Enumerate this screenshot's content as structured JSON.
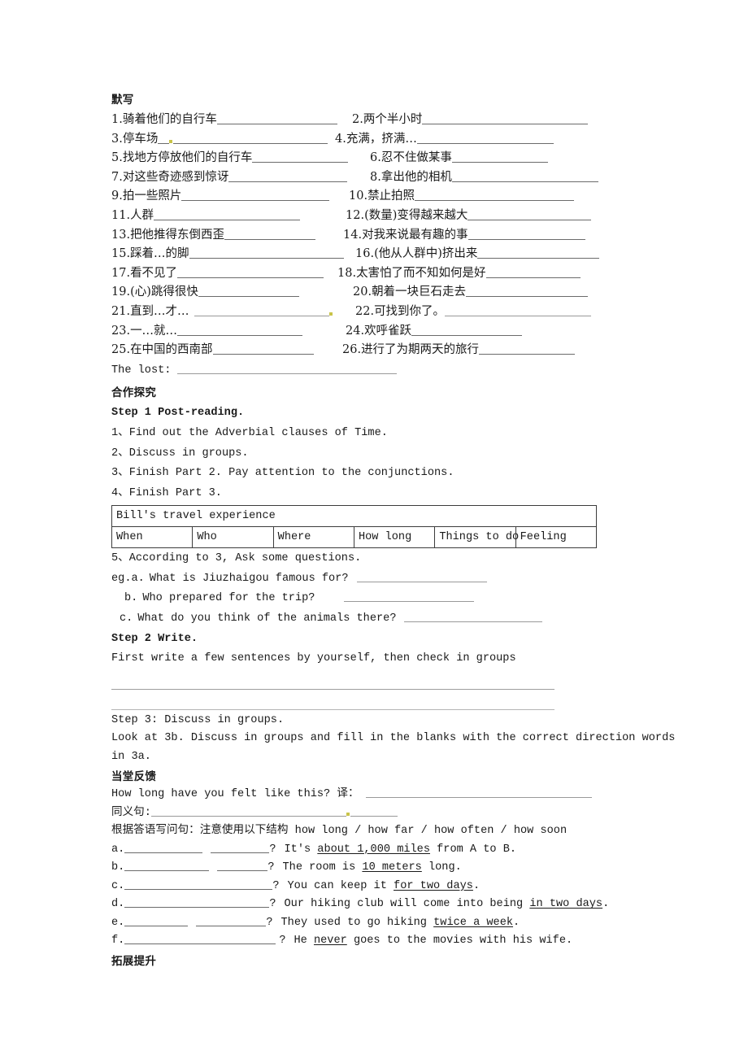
{
  "document": {
    "sections": {
      "dictation_title": "默写",
      "cooperation_title": "合作探究",
      "feedback_title": "当堂反馈",
      "extension_title": "拓展提升"
    },
    "dictation_items": [
      {
        "num": "1.",
        "text": "骑着他们的自行车"
      },
      {
        "num": "2.",
        "text": "两个半小时"
      },
      {
        "num": "3.",
        "text": "停车场"
      },
      {
        "num": "4.",
        "text": "充满，挤满…"
      },
      {
        "num": "5.",
        "text": "找地方停放他们的自行车"
      },
      {
        "num": "6.",
        "text": "忍不住做某事"
      },
      {
        "num": "7.",
        "text": "对这些奇迹感到惊讶"
      },
      {
        "num": "8.",
        "text": "拿出他的相机"
      },
      {
        "num": "9.",
        "text": "拍一些照片"
      },
      {
        "num": "10.",
        "text": "禁止拍照"
      },
      {
        "num": "11.",
        "text": "人群"
      },
      {
        "num": "12.",
        "text": "(数量)变得越来越大"
      },
      {
        "num": "13.",
        "text": "把他推得东倒西歪"
      },
      {
        "num": "14.",
        "text": "对我来说最有趣的事"
      },
      {
        "num": "15.",
        "text": "踩着…的脚"
      },
      {
        "num": "16.",
        "text": "(他从人群中)挤出来"
      },
      {
        "num": "17.",
        "text": "看不见了"
      },
      {
        "num": "18.",
        "text": "太害怕了而不知如何是好"
      },
      {
        "num": "19.",
        "text": "(心)跳得很快"
      },
      {
        "num": "20.",
        "text": "朝着一块巨石走去"
      },
      {
        "num": "21.",
        "text": "直到…才…"
      },
      {
        "num": "22.",
        "text": "可找到你了。"
      },
      {
        "num": "23.",
        "text": "一…就…"
      },
      {
        "num": "24.",
        "text": "欢呼雀跃"
      },
      {
        "num": "25.",
        "text": "在中国的西南部"
      },
      {
        "num": "26.",
        "text": "进行了为期两天的旅行"
      }
    ],
    "the_lost_label": "The lost:",
    "step1": {
      "heading": "Step 1  Post-reading.",
      "items": [
        "1、Find out the Adverbial clauses of Time.",
        "2、Discuss in groups.",
        "3、Finish Part 2. Pay attention to the conjunctions.",
        "4、Finish Part 3."
      ],
      "item5": "5、According to 3, Ask some questions.",
      "questions": [
        {
          "label": "eg.a.",
          "text": "What is Jiuzhaigou famous for?"
        },
        {
          "label": "b.",
          "text": "Who prepared for the trip?"
        },
        {
          "label": "c.",
          "text": "What do you think of the animals there?"
        }
      ]
    },
    "table": {
      "title": "Bill's travel experience",
      "headers": [
        "When",
        "Who",
        "Where",
        "How long",
        "Things to do",
        "Feeling"
      ]
    },
    "step2": {
      "heading": "Step 2 Write.",
      "instruction": "First write a few sentences by yourself, then check in groups"
    },
    "step3": {
      "heading": "Step 3: Discuss in groups.",
      "instruction_line1": "Look at 3b. Discuss in groups and fill in the blanks with the correct direction words",
      "instruction_line2": "in 3a."
    },
    "feedback": {
      "q_sentence": "How long have you felt like this? 译：",
      "synonym_label": "同义句:",
      "instruction": "根据答语写问句：注意使用以下结构 how long / how far / how often / how soon",
      "items": [
        {
          "label": "a.",
          "answer_prefix": "It's ",
          "answer_underline": "about 1,000 miles",
          "answer_suffix": " from A to B.",
          "blanks": 2
        },
        {
          "label": "b.",
          "answer_prefix": "The room is ",
          "answer_underline": "10 meters",
          "answer_suffix": " long.",
          "blanks": 2
        },
        {
          "label": "c.",
          "answer_prefix": "You can keep it ",
          "answer_underline": "for two days",
          "answer_suffix": ".",
          "blanks": 1
        },
        {
          "label": "d.",
          "answer_prefix": "Our hiking club will come into being ",
          "answer_underline": "in two days",
          "answer_suffix": ".",
          "blanks": 1
        },
        {
          "label": "e.",
          "answer_prefix": "They used to go hiking ",
          "answer_underline": "twice a week",
          "answer_suffix": ".",
          "blanks": 2
        },
        {
          "label": "f.",
          "answer_prefix": "He ",
          "answer_underline": "never",
          "answer_suffix": " goes to the movies with his wife.",
          "blanks": 1
        }
      ],
      "question_mark": "?"
    }
  }
}
